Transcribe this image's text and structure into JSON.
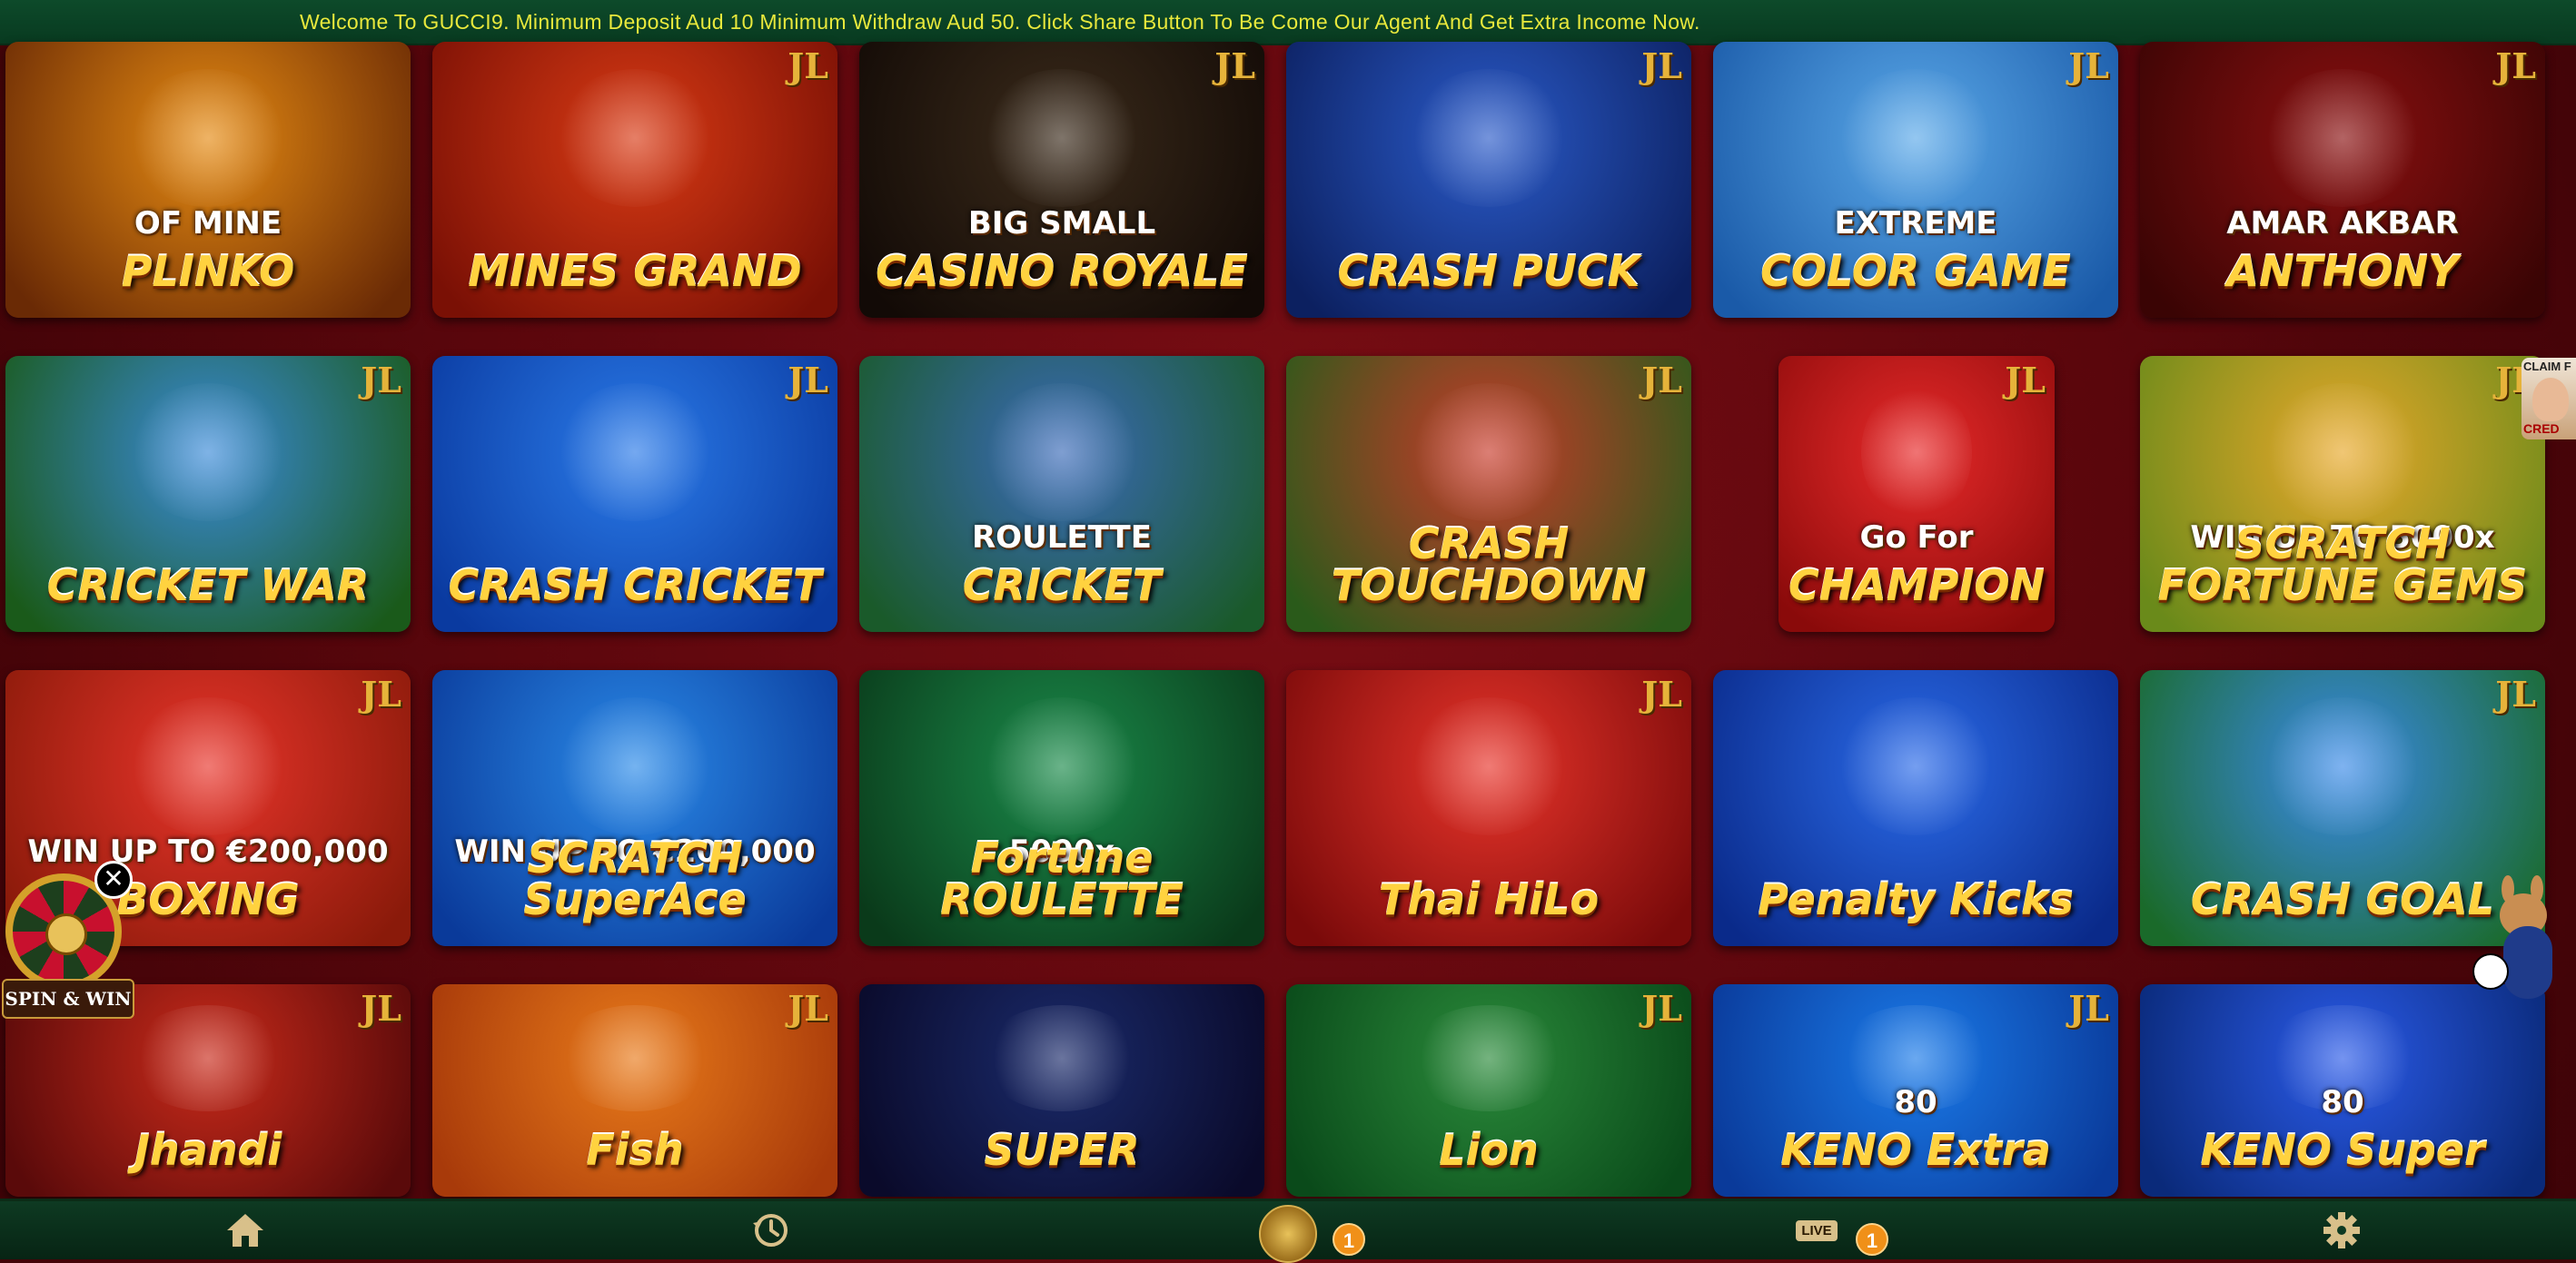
{
  "marquee": {
    "text": "Welcome To GUCCI9. Minimum Deposit Aud 10 Minimum Withdraw Aud 50. Click Share Button To Be Come Our Agent And Get Extra Income Now."
  },
  "provider_badge": "JL",
  "games": [
    {
      "title": "PLINKO",
      "subtitle": "OF MINE",
      "jl": false,
      "bg": [
        "#e58a12",
        "#6a2a05"
      ]
    },
    {
      "title": "MINES GRAND",
      "subtitle": "",
      "jl": true,
      "bg": [
        "#d83a14",
        "#7a1005"
      ]
    },
    {
      "title": "CASINO ROYALE",
      "subtitle": "BIG SMALL",
      "jl": true,
      "bg": [
        "#3a2a1a",
        "#120a06"
      ]
    },
    {
      "title": "CRASH PUCK",
      "subtitle": "",
      "jl": true,
      "bg": [
        "#2a5ac8",
        "#0c2060"
      ]
    },
    {
      "title": "COLOR GAME",
      "subtitle": "EXTREME",
      "jl": true,
      "bg": [
        "#5aa8e8",
        "#1a5aa8"
      ]
    },
    {
      "title": "ANTHONY",
      "subtitle": "AMAR AKBAR",
      "jl": true,
      "bg": [
        "#8a1010",
        "#3a0404"
      ]
    },
    {
      "title": "CRICKET WAR",
      "subtitle": "",
      "jl": true,
      "bg": [
        "#3a8ad8",
        "#1a5a1a"
      ]
    },
    {
      "title": "CRASH CRICKET",
      "subtitle": "",
      "jl": true,
      "bg": [
        "#2a7ae8",
        "#0a3aa0"
      ]
    },
    {
      "title": "CRICKET",
      "subtitle": "ROULETTE",
      "jl": false,
      "bg": [
        "#3a6ab8",
        "#1a5a2a"
      ]
    },
    {
      "title": "CRASH TOUCHDOWN",
      "subtitle": "",
      "jl": true,
      "bg": [
        "#c83a2a",
        "#2a5a1a"
      ]
    },
    {
      "title": "CHAMPION",
      "subtitle": "Go For",
      "jl": true,
      "bg": [
        "#e82a2a",
        "#8a0a0a"
      ]
    },
    {
      "title": "SCRATCH FORTUNE GEMS",
      "subtitle": "WIN UP TO 5000x",
      "jl": true,
      "bg": [
        "#e8a82a",
        "#6a8a1a"
      ]
    },
    {
      "title": "BOXING",
      "subtitle": "WIN UP TO €200,000",
      "jl": true,
      "bg": [
        "#e8342a",
        "#8a1a0a"
      ]
    },
    {
      "title": "SCRATCH SuperAce",
      "subtitle": "WIN UP TO €200,000",
      "jl": false,
      "bg": [
        "#2a8ae8",
        "#0a3a9a"
      ]
    },
    {
      "title": "Fortune ROULETTE",
      "subtitle": "5000x",
      "jl": false,
      "bg": [
        "#1a8a4a",
        "#0a3a1a"
      ]
    },
    {
      "title": "Thai HiLo",
      "subtitle": "",
      "jl": true,
      "bg": [
        "#e8342a",
        "#7a0a0a"
      ]
    },
    {
      "title": "Penalty Kicks",
      "subtitle": "",
      "jl": false,
      "bg": [
        "#2a6ae8",
        "#0a2a8a"
      ]
    },
    {
      "title": "CRASH GOAL",
      "subtitle": "",
      "jl": true,
      "bg": [
        "#3a8ae8",
        "#1a6a2a"
      ]
    },
    {
      "title": "Jhandi",
      "subtitle": "",
      "jl": true,
      "bg": [
        "#c82a1a",
        "#5a0a0a"
      ]
    },
    {
      "title": "Fish",
      "subtitle": "",
      "jl": true,
      "bg": [
        "#e87a1a",
        "#a83a0a"
      ]
    },
    {
      "title": "SUPER",
      "subtitle": "",
      "jl": false,
      "bg": [
        "#1a2a6a",
        "#0a0a2a"
      ]
    },
    {
      "title": "Lion",
      "subtitle": "",
      "jl": true,
      "bg": [
        "#2a8a3a",
        "#0a4a1a"
      ]
    },
    {
      "title": "KENO Extra",
      "subtitle": "80",
      "jl": true,
      "bg": [
        "#1a7ae8",
        "#0a3a9a"
      ]
    },
    {
      "title": "KENO Super",
      "subtitle": "80",
      "jl": false,
      "bg": [
        "#2a5ae8",
        "#0a2a7a"
      ]
    }
  ],
  "widgets": {
    "spin_label": "SPIN & WIN",
    "close_glyph": "✕",
    "claim_top": "CLAIM F",
    "claim_bottom": "CRED"
  },
  "bottom_nav": {
    "items": [
      {
        "name": "home",
        "icon": "home-icon"
      },
      {
        "name": "history",
        "icon": "history-icon"
      },
      {
        "name": "rewards",
        "icon": "chip-avatar-icon",
        "badge": "1"
      },
      {
        "name": "live",
        "icon": "live-icon",
        "badge": "1",
        "live_text": "LIVE"
      },
      {
        "name": "settings",
        "icon": "gear-icon"
      }
    ]
  }
}
